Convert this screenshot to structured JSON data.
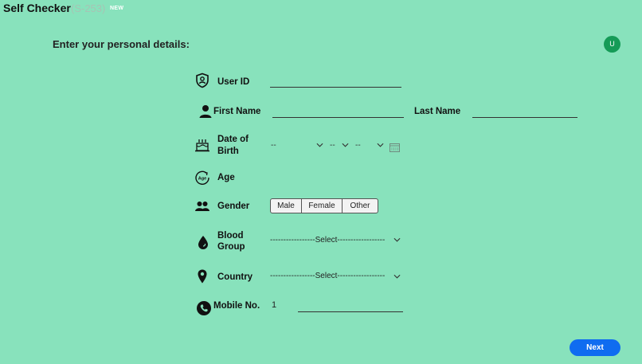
{
  "header": {
    "title": "Self Checker",
    "code": "(S-253)",
    "badge": "NEW"
  },
  "form": {
    "section_title": "Enter your personal details:",
    "user_id": {
      "label": "User ID",
      "value": ""
    },
    "first_name": {
      "label": "First Name",
      "value": ""
    },
    "last_name": {
      "label": "Last Name",
      "value": ""
    },
    "dob": {
      "label_line1": "Date of",
      "label_line2": "Birth",
      "day": "--",
      "month": "--",
      "year": "--"
    },
    "age": {
      "label": "Age",
      "icon_text": "Age"
    },
    "gender": {
      "label": "Gender",
      "options": [
        "Male",
        "Female",
        "Other"
      ]
    },
    "blood_group": {
      "label_line1": "Blood",
      "label_line2": "Group",
      "value": "-----------------Select------------------"
    },
    "country": {
      "label": "Country",
      "value": "-----------------Select------------------"
    },
    "mobile": {
      "label": "Mobile No.",
      "country_code": "1",
      "value": ""
    }
  },
  "user": {
    "avatar_initial": "U"
  },
  "actions": {
    "next_label": "Next"
  },
  "colors": {
    "background": "#88e2bc",
    "accent": "#0f6cf0",
    "avatar": "#159b57"
  },
  "icons": [
    "shield-user-icon",
    "person-icon",
    "birthday-cake-icon",
    "age-icon",
    "group-icon",
    "blood-drop-icon",
    "location-pin-icon",
    "phone-icon",
    "calendar-icon",
    "chevron-down-icon"
  ]
}
